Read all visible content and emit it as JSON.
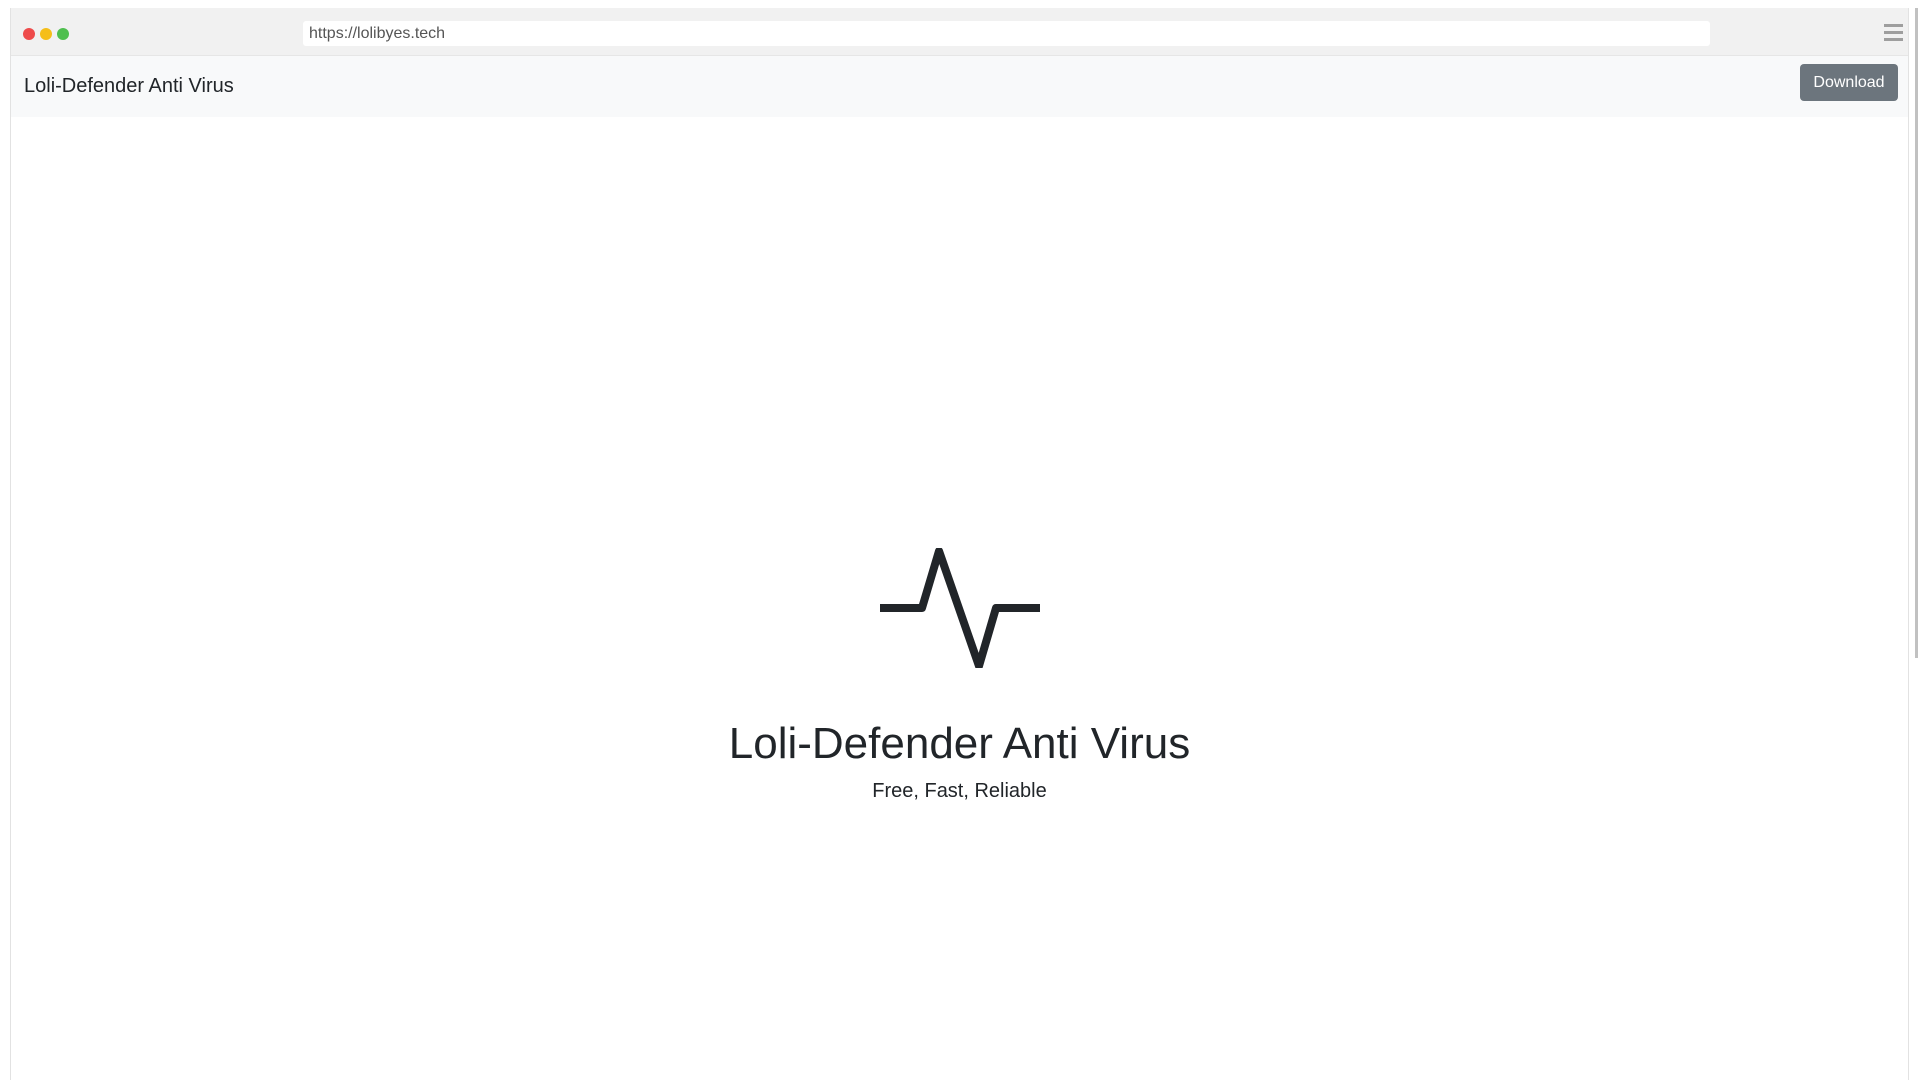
{
  "browser": {
    "url": "https://lolibyes.tech",
    "traffic_lights": {
      "close_color": "#ee4b4b",
      "minimize_color": "#f5be19",
      "maximize_color": "#4fbf4f"
    }
  },
  "navbar": {
    "brand": "Loli-Defender Anti Virus",
    "download_label": "Download",
    "download_color": "#6c757d"
  },
  "hero": {
    "icon": "activity-pulse-icon",
    "title": "Loli-Defender Anti Virus",
    "subtitle": "Free, Fast, Reliable"
  }
}
